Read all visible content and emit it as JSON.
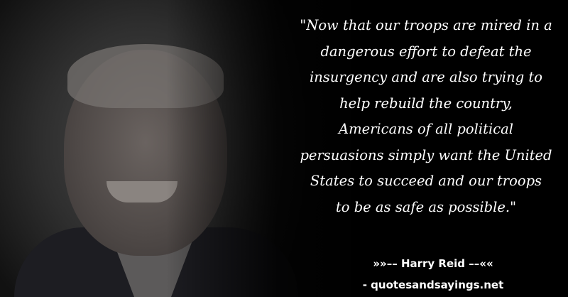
{
  "quote_lines": [
    "\"Now that our troops are mired in a",
    "dangerous effort to defeat the",
    "insurgency and are also trying to",
    "help rebuild the country,",
    "Americans of all political",
    "persuasions simply want the United",
    "States to succeed and our troops",
    "to be as safe as possible.\""
  ],
  "author": "»»–– Harry Reid ––««",
  "site": "- quotesandsayings.net"
}
